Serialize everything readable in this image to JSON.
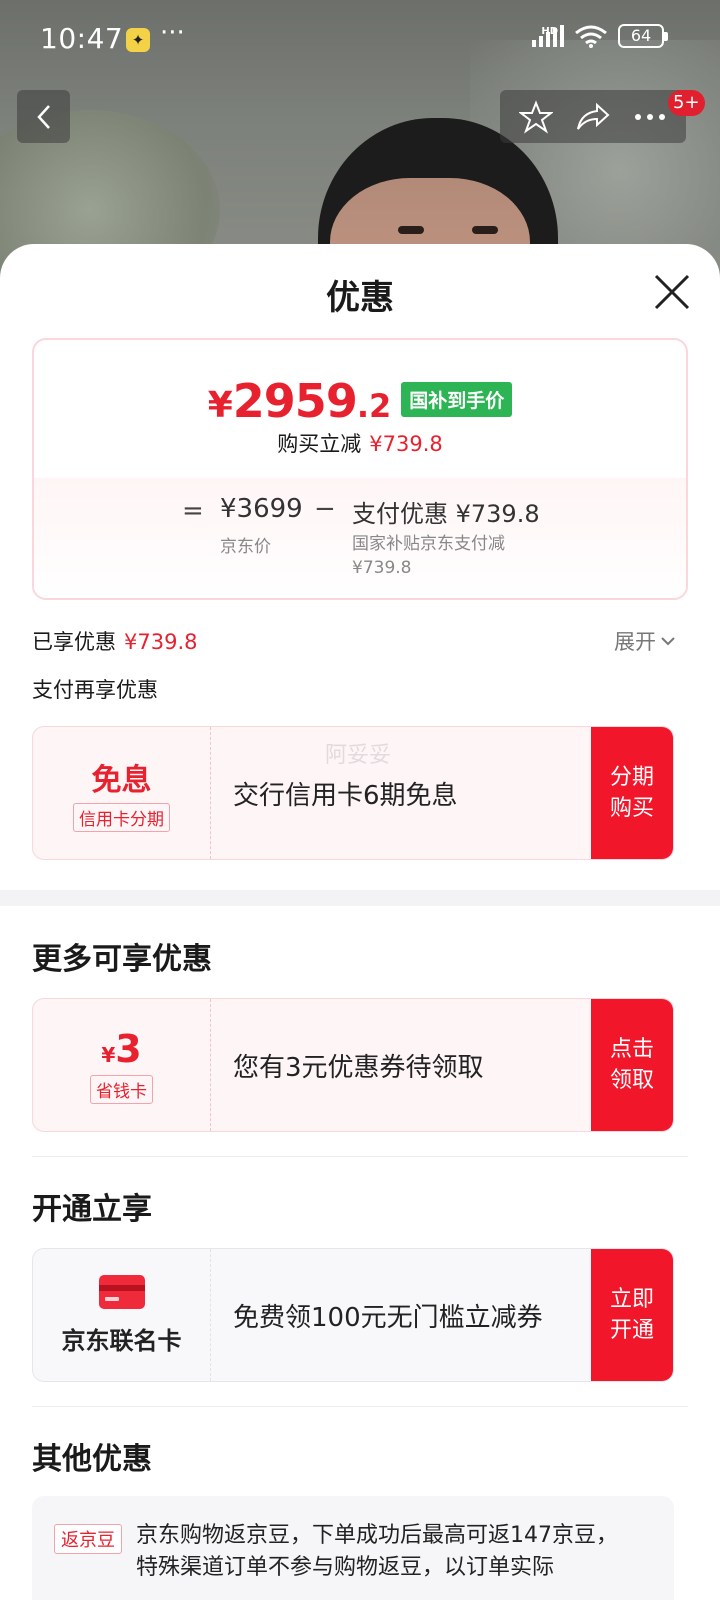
{
  "status_bar": {
    "time": "10:47",
    "dots": "···",
    "network": "HD",
    "battery": "64",
    "wifi_sub": "7"
  },
  "top_nav": {
    "badge": "5+"
  },
  "sheet": {
    "title": "优惠",
    "price_card": {
      "currency": "¥",
      "price_int": "2959",
      "price_dec": ".2",
      "price_tag": "国补到手价",
      "reduce_label": "购买立减",
      "reduce_amount": "¥739.8",
      "equals": "=",
      "jd_price": "¥3699",
      "jd_price_label": "京东价",
      "minus": "−",
      "pay_discount": "支付优惠 ¥739.8",
      "pay_discount_note": "国家补贴京东支付减 ¥739.8"
    },
    "enjoyed_label": "已享优惠",
    "enjoyed_amount": "¥739.8",
    "expand_label": "展开",
    "pay_more_label": "支付再享优惠",
    "installment": {
      "big": "免息",
      "sub": "信用卡分期",
      "text": "交行信用卡6期免息",
      "button": "分期购买",
      "watermark": "阿妥妥"
    },
    "more_title": "更多可享优惠",
    "coupon": {
      "currency": "¥",
      "amount": "3",
      "sub": "省钱卡",
      "text": "您有3元优惠券待领取",
      "button": "点击领取"
    },
    "open_title": "开通立享",
    "jd_card": {
      "label": "京东联名卡",
      "text": "免费领100元无门槛立减券",
      "button": "立即开通"
    },
    "other_title": "其他优惠",
    "other": {
      "tag": "返京豆",
      "text": "京东购物返京豆，下单成功后最高可返147京豆，特殊渠道订单不参与购物返豆，以订单实际"
    }
  },
  "colors": {
    "accent_red": "#e8212f",
    "button_red": "#f1162a",
    "green_tag": "#2db454"
  }
}
